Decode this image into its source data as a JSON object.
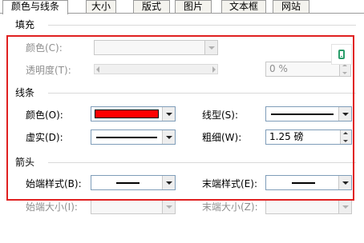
{
  "tabs": [
    {
      "label": "颜色与线条",
      "active": true
    },
    {
      "label": "大小",
      "active": false
    },
    {
      "label": "版式",
      "active": false
    },
    {
      "label": "图片",
      "active": false
    },
    {
      "label": "文本框",
      "active": false
    },
    {
      "label": "网站",
      "active": false
    }
  ],
  "fill": {
    "group_title": "填充",
    "color_label": "颜色(C):",
    "transparency_label": "透明度(T):",
    "transparency_value": "0 %"
  },
  "line": {
    "group_title": "线条",
    "color_label": "颜色(O):",
    "color_value_hex": "#ff0000",
    "style_label": "线型(S):",
    "dash_label": "虚实(D):",
    "weight_label": "粗细(W):",
    "weight_value": "1.25 磅"
  },
  "arrows": {
    "group_title": "箭头",
    "begin_style_label": "始端样式(B):",
    "end_style_label": "末端样式(E):",
    "begin_size_label": "始端大小(I):",
    "end_size_label": "末端大小(Z):"
  },
  "icons": {
    "side": "phone-icon"
  },
  "colors": {
    "highlight": "#e02020",
    "line_color": "#ff0000"
  }
}
